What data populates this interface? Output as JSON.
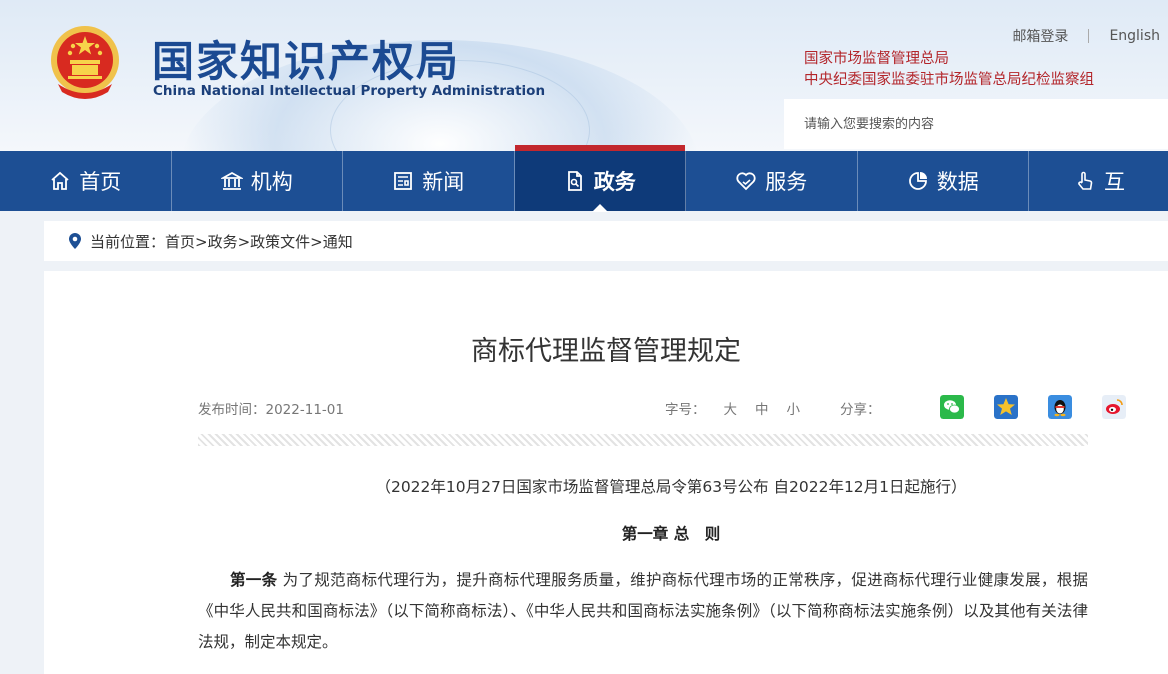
{
  "header": {
    "logo_cn": "国家知识产权局",
    "logo_en": "China National Intellectual Property Administration",
    "mail_login": "邮箱登录",
    "english": "English",
    "admin_line1": "国家市场监督管理总局",
    "admin_line2": "中央纪委国家监委驻市场监管总局纪检监察组",
    "search_placeholder": "请输入您要搜索的内容"
  },
  "nav": {
    "items": [
      {
        "label": "首页",
        "icon": "home-icon"
      },
      {
        "label": "机构",
        "icon": "institution-icon"
      },
      {
        "label": "新闻",
        "icon": "news-icon"
      },
      {
        "label": "政务",
        "icon": "document-icon",
        "active": true
      },
      {
        "label": "服务",
        "icon": "heart-service-icon"
      },
      {
        "label": "数据",
        "icon": "pie-chart-icon"
      },
      {
        "label": "互",
        "icon": "hand-pointer-icon"
      }
    ]
  },
  "breadcrumb": {
    "prefix": "当前位置：",
    "path": "首页>政务>政策文件>通知"
  },
  "article": {
    "title": "商标代理监督管理规定",
    "publish_time": "发布时间：2022-11-01",
    "font_size_label": "字号：",
    "font_large": "大",
    "font_medium": "中",
    "font_small": "小",
    "share_label": "分享：",
    "share_icons": [
      "wechat-icon",
      "qzone-star-icon",
      "qq-penguin-icon",
      "weibo-icon"
    ],
    "subtitle": "（2022年10月27日国家市场监督管理总局令第63号公布 自2022年12月1日起施行）",
    "chapter": "第一章 总　则",
    "article1_label": "第一条",
    "article1_text": "  为了规范商标代理行为，提升商标代理服务质量，维护商标代理市场的正常秩序，促进商标代理行业健康发展，根据《中华人民共和国商标法》（以下简称商标法）、《中华人民共和国商标法实施条例》（以下简称商标法实施条例）以及其他有关法律法规，制定本规定。"
  },
  "colors": {
    "nav_bg": "#1d4f94",
    "nav_active_bg": "#0e3a79",
    "accent_red": "#c2272d",
    "logo_blue": "#1b4a92"
  }
}
